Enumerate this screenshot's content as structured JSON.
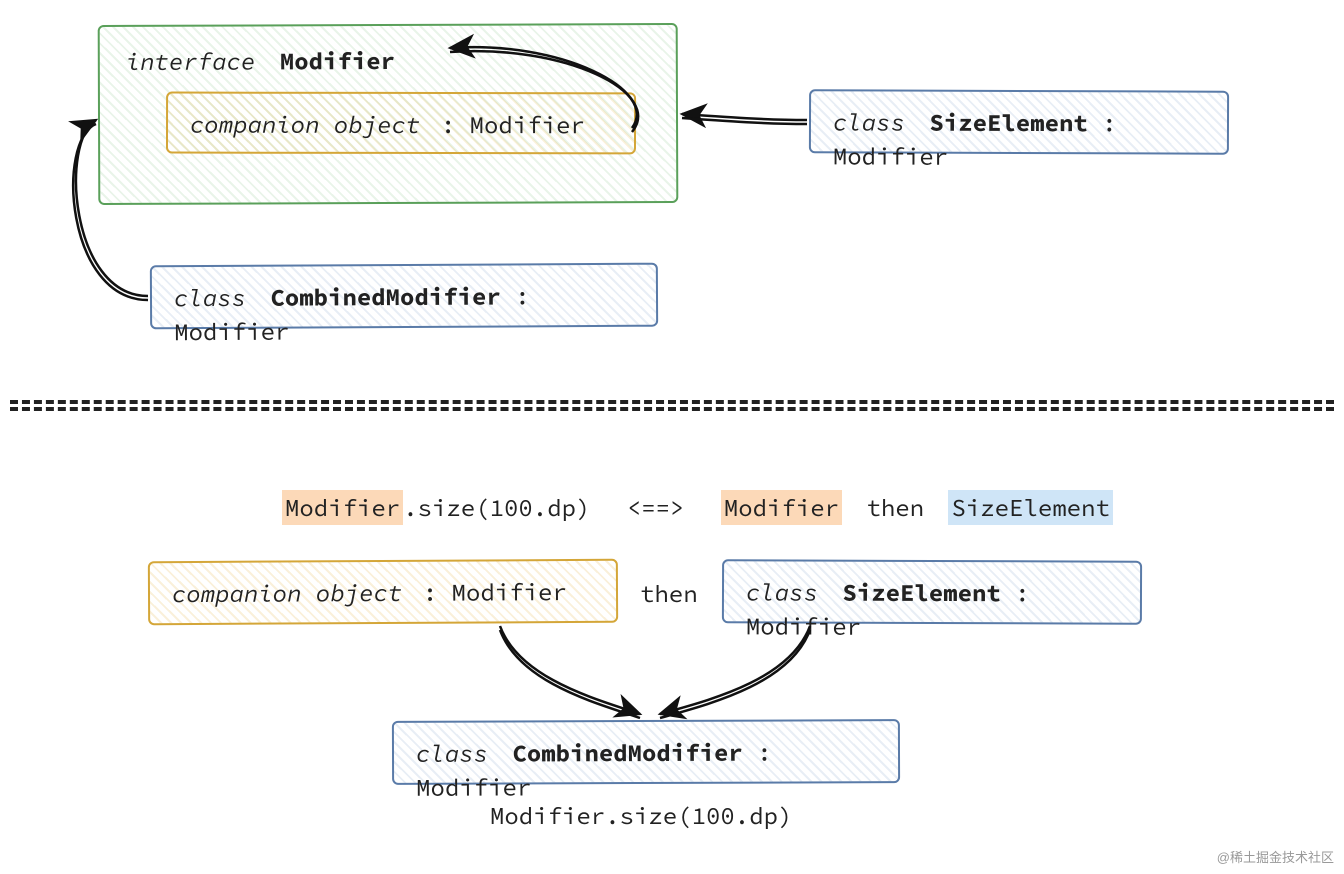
{
  "top": {
    "interface": {
      "kw": "interface",
      "name": "Modifier"
    },
    "companion": {
      "kw": "companion object",
      "type": ": Modifier"
    },
    "sizeElement": {
      "kw": "class",
      "name": "SizeElement",
      "type": ": Modifier"
    },
    "combined": {
      "kw": "class",
      "name": "CombinedModifier",
      "type": ": Modifier"
    }
  },
  "bottom": {
    "expression": {
      "lhs_hl": "Modifier",
      "lhs_rest": ".size(100.dp)",
      "equiv": "<==>",
      "rhs_hl1": "Modifier",
      "then": "then",
      "rhs_hl2": "SizeElement"
    },
    "companion": {
      "kw": "companion object",
      "type": ": Modifier"
    },
    "then_word": "then",
    "sizeElement": {
      "kw": "class",
      "name": "SizeElement",
      "type": ": Modifier"
    },
    "combined": {
      "kw": "class",
      "name": "CombinedModifier",
      "type": ": Modifier"
    },
    "result": "Modifier.size(100.dp)"
  },
  "watermark": "@稀土掘金技术社区"
}
